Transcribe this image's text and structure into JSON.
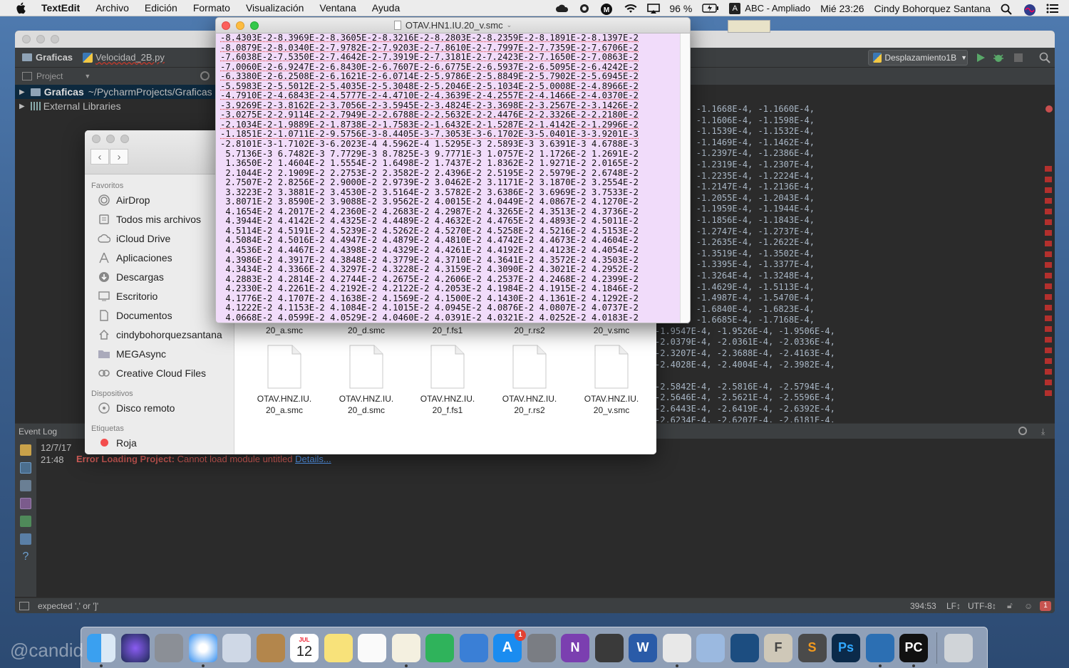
{
  "menubar": {
    "app": "TextEdit",
    "menus": [
      "Archivo",
      "Edición",
      "Formato",
      "Visualización",
      "Ventana",
      "Ayuda"
    ],
    "battery": "96 %",
    "input_source": "ABC - Ampliado",
    "input_letter": "A",
    "clock": "Mié 23:26",
    "user": "Cindy Bohorquez Santana"
  },
  "pycharm": {
    "breadcrumb_project": "Graficas",
    "breadcrumb_file": "Velocidad_2B.py",
    "run_config": "Desplazamiento1B",
    "project_panel_label": "Project",
    "tree": [
      {
        "name": "Graficas",
        "path": "~/PycharmProjects/Graficas"
      },
      {
        "name": "External Libraries",
        "path": ""
      }
    ],
    "editor_lines": [
      "… 5E-4, -1.1668E-4, -1.1660E-4,",
      "… 4E-4, -1.1606E-4, -1.1598E-4,",
      "… 9E-4, -1.1539E-4, -1.1532E-4,",
      "… 0E-4, -1.1469E-4, -1.1462E-4,",
      "… 6E-4, -1.2397E-4, -1.2386E-4,",
      "… 7E-4, -1.2319E-4, -1.2307E-4,",
      "… 5E-4, -1.2235E-4, -1.2224E-4,",
      "… 9E-4, -1.2147E-4, -1.2136E-4,",
      "… 7E-4, -1.2055E-4, -1.2043E-4,",
      "… 9E-4, -1.1959E-4, -1.1944E-4,",
      "… 8E-4, -1.1856E-4, -1.1843E-4,",
      "… 4E-4, -1.2747E-4, -1.2737E-4,",
      "… 2E-4, -1.2635E-4, -1.2622E-4,",
      "… 2E-4, -1.3519E-4, -1.3502E-4,",
      "… 9E-4, -1.3395E-4, -1.3377E-4,",
      "… 1E-4, -1.3264E-4, -1.3248E-4,",
      "… 7E-4, -1.4629E-4, -1.5113E-4,",
      "… 6E-4, -1.4987E-4, -1.5470E-4,",
      "… 0E-4, -1.6840E-4, -1.6823E-4,",
      "… 7E-4, -1.6685E-4, -1.7168E-4,",
      "-1.9547E-4, -1.9526E-4, -1.9506E-4,",
      "-2.0379E-4, -2.0361E-4, -2.0336E-4,",
      "-2.3207E-4, -2.3688E-4, -2.4163E-4,",
      "-2.4028E-4, -2.4004E-4, -2.3982E-4,",
      "",
      "-2.5842E-4, -2.5816E-4, -2.5794E-4,",
      "-2.5646E-4, -2.5621E-4, -2.5596E-4,",
      "-2.6443E-4, -2.6419E-4, -2.6392E-4,",
      "-2.6234E-4, -2.6207E-4, -2.6181E-4,"
    ],
    "event_log_label": "Event Log",
    "log_date": "12/7/17",
    "log_time": "21:48",
    "log_title": "Error Loading Project:",
    "log_text": "Cannot load module untitled",
    "log_link": "Details...",
    "status_msg": "expected ',' or ']'",
    "status_pos": "394:53",
    "status_lf": "LF↕",
    "status_enc": "UTF-8↕",
    "status_badge": "1"
  },
  "finder": {
    "favorites_header": "Favoritos",
    "favorites": [
      "AirDrop",
      "Todos mis archivos",
      "iCloud Drive",
      "Aplicaciones",
      "Descargas",
      "Escritorio",
      "Documentos",
      "cindybohorquezsantana",
      "MEGAsync",
      "Creative Cloud Files"
    ],
    "devices_header": "Dispositivos",
    "devices": [
      "Disco remoto"
    ],
    "tags_header": "Etiquetas",
    "tags": [
      "Roja"
    ],
    "row1_captions": [
      "20_a.smc",
      "20_d.smc",
      "20_f.fs1",
      "20_r.rs2",
      "20_v.smc"
    ],
    "row2_files": [
      {
        "line1": "OTAV.HNZ.IU.",
        "line2": "20_a.smc"
      },
      {
        "line1": "OTAV.HNZ.IU.",
        "line2": "20_d.smc"
      },
      {
        "line1": "OTAV.HNZ.IU.",
        "line2": "20_f.fs1"
      },
      {
        "line1": "OTAV.HNZ.IU.",
        "line2": "20_r.rs2"
      },
      {
        "line1": "OTAV.HNZ.IU.",
        "line2": "20_v.smc"
      }
    ]
  },
  "textedit": {
    "title": "OTAV.HN1.IU.20_v.smc",
    "lines": [
      "-8.4303E-2-8.3969E-2-8.3605E-2-8.3216E-2-8.2803E-2-8.2359E-2-8.1891E-2-8.1397E-2",
      "-8.0879E-2-8.0340E-2-7.9782E-2-7.9203E-2-7.8610E-2-7.7997E-2-7.7359E-2-7.6706E-2",
      "-7.6038E-2-7.5350E-2-7.4642E-2-7.3919E-2-7.3181E-2-7.2423E-2-7.1650E-2-7.0863E-2",
      "-7.0060E-2-6.9247E-2-6.8430E-2-6.7607E-2-6.6775E-2-6.5937E-2-6.5095E-2-6.4242E-2",
      "-6.3380E-2-6.2508E-2-6.1621E-2-6.0714E-2-5.9786E-2-5.8849E-2-5.7902E-2-5.6945E-2",
      "-5.5983E-2-5.5012E-2-5.4035E-2-5.3048E-2-5.2046E-2-5.1034E-2-5.0008E-2-4.8966E-2",
      "-4.7910E-2-4.6843E-2-4.5777E-2-4.4710E-2-4.3639E-2-4.2557E-2-4.1466E-2-4.0370E-2",
      "-3.9269E-2-3.8162E-2-3.7056E-2-3.5945E-2-3.4824E-2-3.3698E-2-3.2567E-2-3.1426E-2",
      "-3.0275E-2-2.9114E-2-2.7949E-2-2.6788E-2-2.5632E-2-2.4476E-2-2.3326E-2-2.2180E-2",
      "-2.1034E-2-1.9889E-2-1.8738E-2-1.7583E-2-1.6432E-2-1.5287E-2-1.4142E-2-1.2996E-2",
      "-1.1851E-2-1.0711E-2-9.5756E-3-8.4405E-3-7.3053E-3-6.1702E-3-5.0401E-3-3.9201E-3",
      "-2.8101E-3-1.7102E-3-6.2023E-4 4.5962E-4 1.5295E-3 2.5893E-3 3.6391E-3 4.6788E-3",
      " 5.7136E-3 6.7482E-3 7.7729E-3 8.7825E-3 9.7771E-3 1.0757E-2 1.1726E-2 1.2691E-2",
      " 1.3650E-2 1.4604E-2 1.5554E-2 1.6498E-2 1.7437E-2 1.8362E-2 1.9271E-2 2.0165E-2",
      " 2.1044E-2 2.1909E-2 2.2753E-2 2.3582E-2 2.4396E-2 2.5195E-2 2.5979E-2 2.6748E-2",
      " 2.7507E-2 2.8256E-2 2.9000E-2 2.9739E-2 3.0462E-2 3.1171E-2 3.1870E-2 3.2554E-2",
      " 3.3223E-2 3.3881E-2 3.4530E-2 3.5164E-2 3.5782E-2 3.6386E-2 3.6969E-2 3.7533E-2",
      " 3.8071E-2 3.8590E-2 3.9088E-2 3.9562E-2 4.0015E-2 4.0449E-2 4.0867E-2 4.1270E-2",
      " 4.1654E-2 4.2017E-2 4.2360E-2 4.2683E-2 4.2987E-2 4.3265E-2 4.3513E-2 4.3736E-2",
      " 4.3944E-2 4.4142E-2 4.4325E-2 4.4489E-2 4.4632E-2 4.4765E-2 4.4893E-2 4.5011E-2",
      " 4.5114E-2 4.5191E-2 4.5239E-2 4.5262E-2 4.5270E-2 4.5258E-2 4.5216E-2 4.5153E-2",
      " 4.5084E-2 4.5016E-2 4.4947E-2 4.4879E-2 4.4810E-2 4.4742E-2 4.4673E-2 4.4604E-2",
      " 4.4536E-2 4.4467E-2 4.4398E-2 4.4329E-2 4.4261E-2 4.4192E-2 4.4123E-2 4.4054E-2",
      " 4.3986E-2 4.3917E-2 4.3848E-2 4.3779E-2 4.3710E-2 4.3641E-2 4.3572E-2 4.3503E-2",
      " 4.3434E-2 4.3366E-2 4.3297E-2 4.3228E-2 4.3159E-2 4.3090E-2 4.3021E-2 4.2952E-2",
      " 4.2883E-2 4.2814E-2 4.2744E-2 4.2675E-2 4.2606E-2 4.2537E-2 4.2468E-2 4.2399E-2",
      " 4.2330E-2 4.2261E-2 4.2192E-2 4.2122E-2 4.2053E-2 4.1984E-2 4.1915E-2 4.1846E-2",
      " 4.1776E-2 4.1707E-2 4.1638E-2 4.1569E-2 4.1500E-2 4.1430E-2 4.1361E-2 4.1292E-2",
      " 4.1222E-2 4.1153E-2 4.1084E-2 4.1015E-2 4.0945E-2 4.0876E-2 4.0807E-2 4.0737E-2",
      " 4.0668E-2 4.0599E-2 4.0529E-2 4.0460E-2 4.0391E-2 4.0321E-2 4.0252E-2 4.0183E-2"
    ]
  },
  "dock": {
    "calendar_month": "JUL",
    "calendar_day": "12",
    "appstore_badge": "1",
    "apps": [
      "finder-icon",
      "siri-icon",
      "launchpad-icon",
      "safari-icon",
      "preview-icon",
      "contacts-icon",
      "calendar-icon",
      "notes-icon",
      "reminders-icon",
      "textedit-icon",
      "numbers-icon",
      "keynote-icon",
      "app-store-icon",
      "system-preferences-icon",
      "onenote-icon",
      "final-cut-icon",
      "word-icon",
      "script-editor-icon",
      "virtualbox-icon",
      "quicktime-icon",
      "font-book-icon",
      "sublime-icon",
      "photoshop-icon",
      "wireshark-icon",
      "pycharm-icon",
      "trash-icon"
    ]
  },
  "watermark": "@candid"
}
